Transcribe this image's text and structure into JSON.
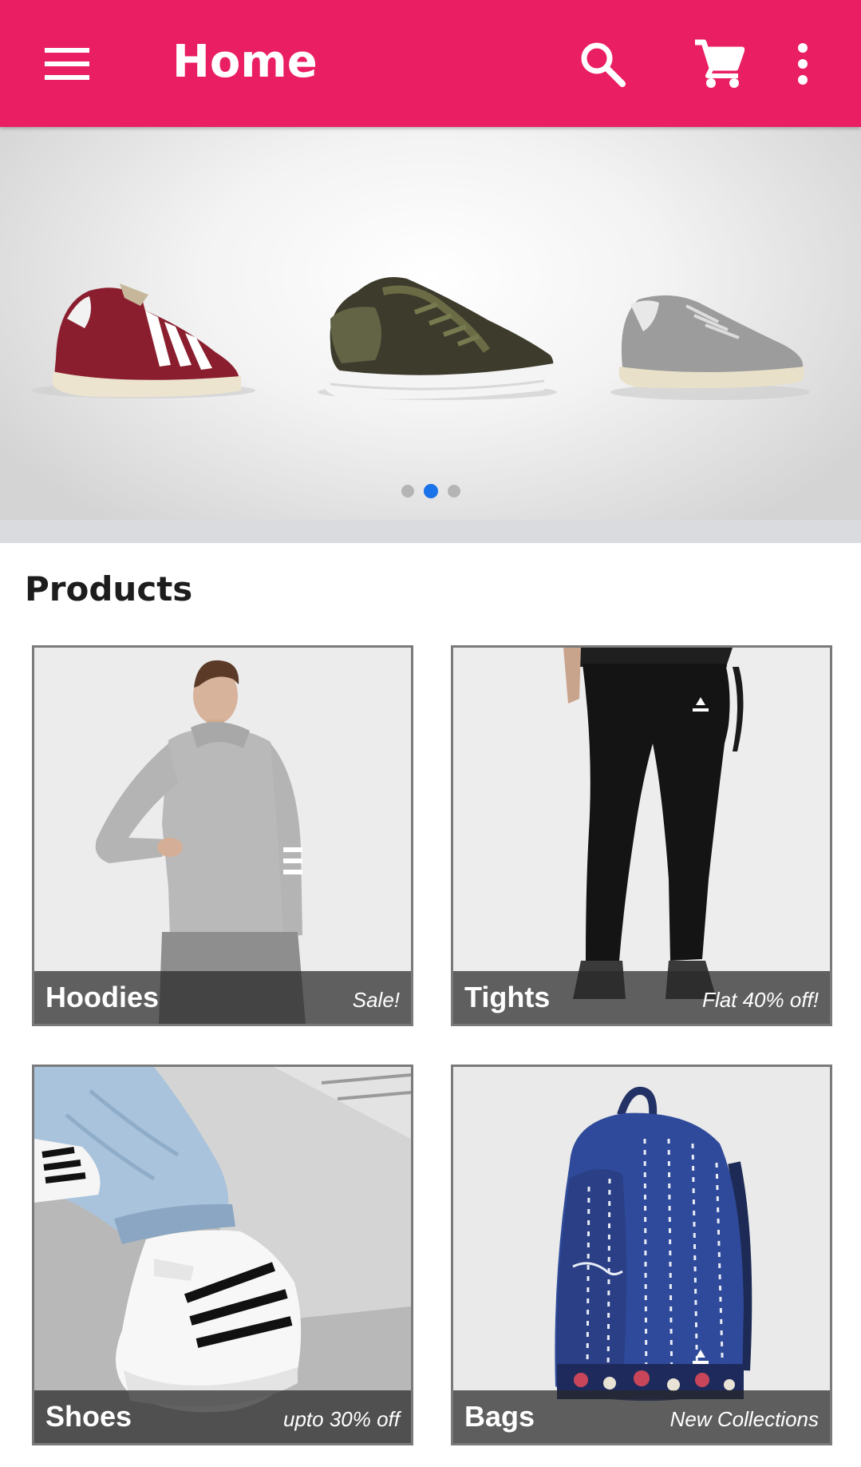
{
  "colors": {
    "primary": "#e91e63",
    "accent": "#1a73e8"
  },
  "appbar": {
    "title": "Home",
    "icons": [
      "menu-icon",
      "search-icon",
      "cart-icon",
      "more-vert-icon"
    ]
  },
  "banner": {
    "slides_count": 3,
    "active_slide": 2
  },
  "products": {
    "heading": "Products",
    "items": [
      {
        "name": "Hoodies",
        "promo": "Sale!"
      },
      {
        "name": "Tights",
        "promo": "Flat 40% off!"
      },
      {
        "name": "Shoes",
        "promo": "upto 30% off"
      },
      {
        "name": "Bags",
        "promo": "New Collections"
      }
    ]
  }
}
